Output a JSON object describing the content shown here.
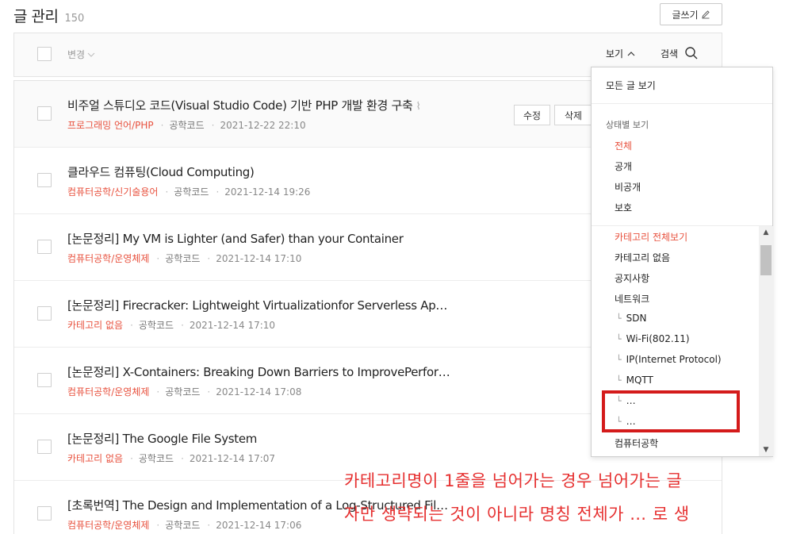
{
  "header": {
    "title": "글 관리",
    "count": "150",
    "write_button": "글쓰기"
  },
  "toolbar": {
    "change_label": "변경",
    "view_label": "보기",
    "search_label": "검색"
  },
  "posts": [
    {
      "title": "비주얼 스튜디오 코드(Visual Studio Code) 기반 PHP 개발 환경 구축",
      "category": "프로그래밍 언어/PHP",
      "author": "공학코드",
      "date": "2021-12-22 22:10",
      "has_attachment": true
    },
    {
      "title": "클라우드 컴퓨팅(Cloud Computing)",
      "category": "컴퓨터공학/신기술용어",
      "author": "공학코드",
      "date": "2021-12-14 19:26"
    },
    {
      "title": "[논문정리] My VM is Lighter (and Safer) than your Container",
      "category": "컴퓨터공학/운영체제",
      "author": "공학코드",
      "date": "2021-12-14 17:10"
    },
    {
      "title": "[논문정리] Firecracker: Lightweight Virtualizationfor Serverless Ap…",
      "category": "카테고리 없음",
      "author": "공학코드",
      "date": "2021-12-14 17:10"
    },
    {
      "title": "[논문정리] X-Containers: Breaking Down Barriers to ImprovePerfor…",
      "category": "컴퓨터공학/운영체제",
      "author": "공학코드",
      "date": "2021-12-14 17:08"
    },
    {
      "title": "[논문정리] The Google File System",
      "category": "카테고리 없음",
      "author": "공학코드",
      "date": "2021-12-14 17:07"
    },
    {
      "title": "[초록번역] The Design and Implementation of a Log-Structured Fil…",
      "category": "컴퓨터공학/운영체제",
      "author": "공학코드",
      "date": "2021-12-14 17:06"
    }
  ],
  "row_actions": {
    "edit": "수정",
    "delete": "삭제"
  },
  "dropdown": {
    "all_posts": "모든 글 보기",
    "status_title": "상태별 보기",
    "status_items": [
      "전체",
      "공개",
      "비공개",
      "보호"
    ],
    "category_all": "카테고리 전체보기",
    "categories": [
      "카테고리 없음",
      "공지사항",
      "네트워크"
    ],
    "sub_categories": [
      "SDN",
      "Wi-Fi(802.11)",
      "IP(Internet Protocol)",
      "MQTT",
      "…",
      "…"
    ],
    "last_category": "컴퓨터공학",
    "sub_mark": "└"
  },
  "annotation": {
    "line1": "카테고리명이 1줄을 넘어가는 경우 넘어가는 글",
    "line2": "자만 생략되는 것이 아니라 명칭 전체가 … 로 생"
  },
  "colors": {
    "accent": "#e8523f",
    "annotation": "#e63030"
  }
}
